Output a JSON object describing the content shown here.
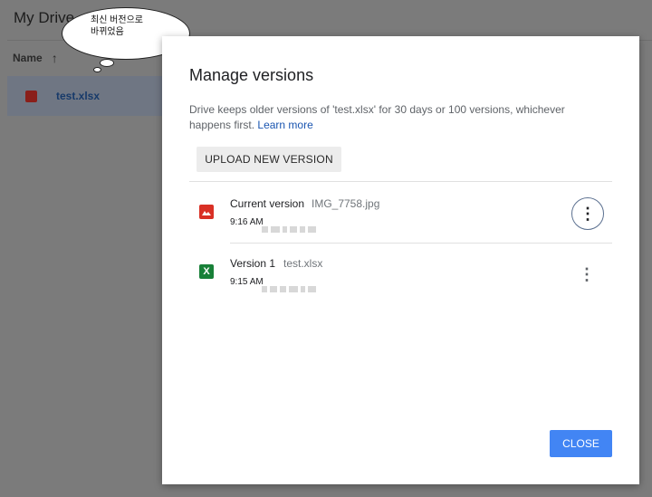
{
  "drive": {
    "title": "My Drive",
    "column_name": "Name",
    "sort_icon": "arrow-up-icon",
    "file_name": "test.xlsx"
  },
  "bubble": {
    "text_line1": "최신 버전으로",
    "text_line2": "바뀌었음"
  },
  "dialog": {
    "title": "Manage versions",
    "description": "Drive keeps older versions of 'test.xlsx' for 30 days or 100 versions, whichever happens first.",
    "learn_more": "Learn more",
    "upload_label": "UPLOAD NEW VERSION",
    "close_label": "CLOSE",
    "versions": [
      {
        "label": "Current version",
        "file": "IMG_7758.jpg",
        "time": "9:16 AM",
        "icon": "image-file-icon",
        "icon_color": "#d93025"
      },
      {
        "label": "Version 1",
        "file": "test.xlsx",
        "time": "9:15 AM",
        "icon": "sheets-file-icon",
        "icon_color": "#188038",
        "icon_glyph": "X"
      }
    ]
  },
  "colors": {
    "accent": "#4285f4",
    "link": "#1a55b0",
    "overlay": "#7b7b7b"
  }
}
